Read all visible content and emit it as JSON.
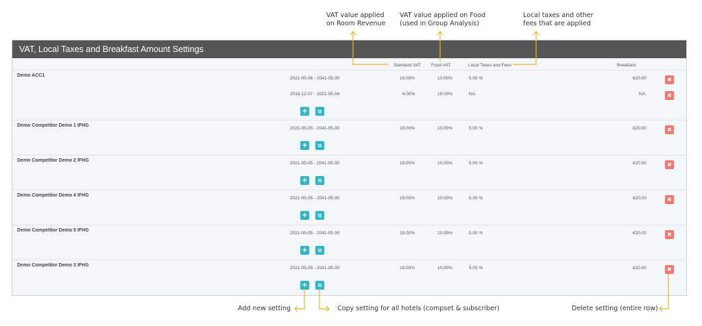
{
  "annotations": {
    "vat_room": [
      "VAT value applied",
      "on Room Revenue"
    ],
    "vat_food": [
      "VAT value applied on Food",
      "(used in Group Analysis)"
    ],
    "local_taxes": [
      "Local taxes and other",
      "fees that are applied"
    ],
    "add_new": "Add new setting",
    "copy_setting": "Copy setting for all hotels (compset & subscriber)",
    "delete_setting": "Delete setting (entire row)"
  },
  "panel": {
    "title": "VAT, Local Taxes and Breakfast Amount Settings",
    "columns": {
      "standard_vat": "Standard VAT",
      "food_vat": "Food VAT",
      "local_taxes": "Local Taxes and Fees",
      "breakfast": "Breakfast"
    }
  },
  "hotels": [
    {
      "name": "Demo ACC1",
      "settings": [
        {
          "dates": "2021-05-06 - 2041-05-30",
          "standard_vat": "19.00%",
          "food_vat": "10.00%",
          "local_taxes": "5.00 %",
          "breakfast": "€20.00"
        },
        {
          "dates": "2016-12-07 - 2021-05-04",
          "standard_vat": "6.00%",
          "food_vat": "19.00%",
          "local_taxes": "NA",
          "breakfast": "NA"
        }
      ]
    },
    {
      "name": "Demo Competitor Demo 1 IFHG",
      "settings": [
        {
          "dates": "2021-05-05 - 2041-05-30",
          "standard_vat": "19.00%",
          "food_vat": "10.00%",
          "local_taxes": "5.00 %",
          "breakfast": "€20.00"
        }
      ]
    },
    {
      "name": "Demo Competitor Demo 2 IFHG",
      "settings": [
        {
          "dates": "2021-05-05 - 2041-05-30",
          "standard_vat": "19.00%",
          "food_vat": "10.00%",
          "local_taxes": "5.00 %",
          "breakfast": "€20.00"
        }
      ]
    },
    {
      "name": "Demo Competitor Demo 4 IFHG",
      "settings": [
        {
          "dates": "2021-05-05 - 2041-05-30",
          "standard_vat": "19.00%",
          "food_vat": "10.00%",
          "local_taxes": "5.00 %",
          "breakfast": "€20.00"
        }
      ]
    },
    {
      "name": "Demo Competitor Demo 5 IFHG",
      "settings": [
        {
          "dates": "2021-05-05 - 2041-05-30",
          "standard_vat": "19.00%",
          "food_vat": "10.00%",
          "local_taxes": "5.00 %",
          "breakfast": "€20.00"
        }
      ]
    },
    {
      "name": "Demo Competitor Demo 3 IFHG",
      "settings": [
        {
          "dates": "2021-05-05 - 2041-05-30",
          "standard_vat": "19.00%",
          "food_vat": "10.00%",
          "local_taxes": "5.00 %",
          "breakfast": "€20.00"
        }
      ]
    }
  ],
  "buttons": {
    "add": "+",
    "copy": "⧉",
    "delete": "✖"
  },
  "colors": {
    "header_bg": "#555555",
    "accent_teal": "#35b5c8",
    "delete_red": "#ee7a72",
    "annotation_arrow": "#f0b429"
  }
}
